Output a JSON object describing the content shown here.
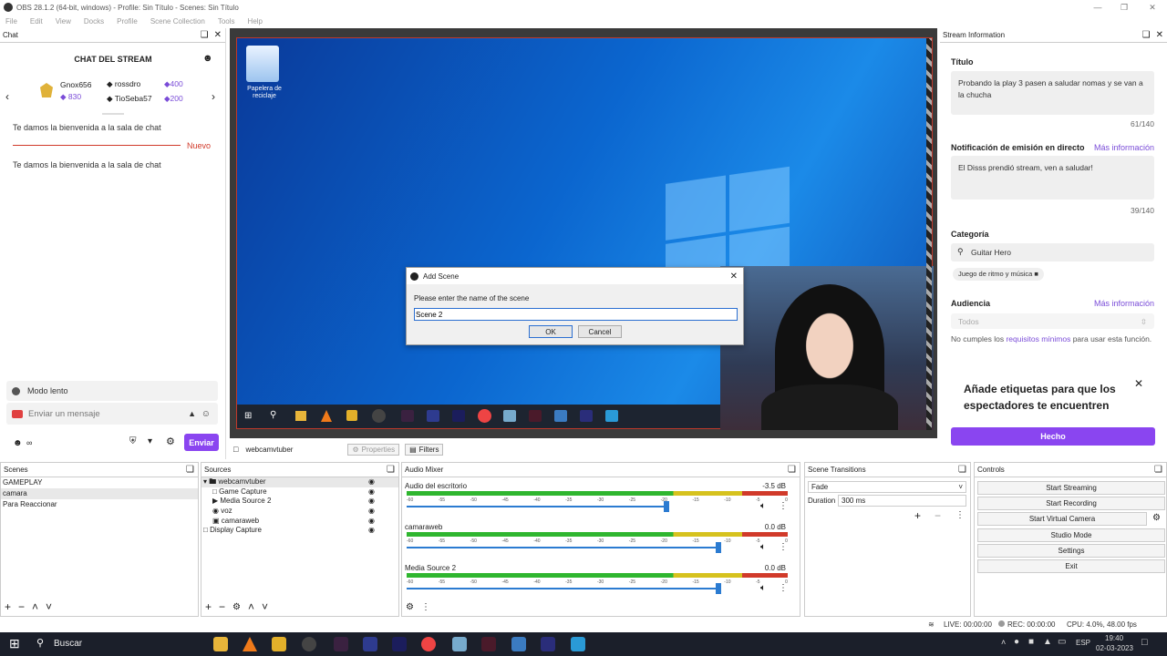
{
  "window": {
    "title": "OBS 28.1.2 (64-bit, windows) - Profile: Sin Título - Scenes: Sin Título"
  },
  "menu": [
    "File",
    "Edit",
    "View",
    "Docks",
    "Profile",
    "Scene Collection",
    "Tools",
    "Help"
  ],
  "chat": {
    "dock_title": "Chat",
    "header": "CHAT DEL STREAM",
    "leaders": [
      {
        "name": "Gnox656",
        "points": "830"
      },
      {
        "name": "rossdro",
        "points": "400"
      },
      {
        "name": "TioSeba57",
        "points": "200"
      }
    ],
    "welcome": "Te damos la bienvenida a la sala de chat",
    "new_label": "Nuevo",
    "welcome2": "Te damos la bienvenida a la sala de chat",
    "slow_mode": "Modo lento",
    "placeholder": "Enviar un mensaje",
    "infinity": "∞",
    "send": "Enviar"
  },
  "desktop": {
    "icon_label": "Papelera de reciclaje"
  },
  "dialog": {
    "title": "Add Scene",
    "prompt": "Please enter the name of the scene",
    "value": "Scene 2",
    "ok": "OK",
    "cancel": "Cancel"
  },
  "stream_info": {
    "dock_title": "Stream Information",
    "title_label": "Título",
    "title_value": "Probando la play 3 pasen a saludar nomas y se van a la chucha",
    "title_count": "61/140",
    "notif_label": "Notificación de emisión en directo",
    "more_info": "Más información",
    "notif_value": "El Disss prendió stream, ven a saludar!",
    "notif_count": "39/140",
    "category_label": "Categoría",
    "category_value": "Guitar Hero",
    "tag": "Juego de ritmo y música",
    "audience_label": "Audiencia",
    "audience_more": "Más información",
    "audience_select": "Todos",
    "audience_note_pre": "No cumples los ",
    "audience_note_link": "requisitos mínimos",
    "audience_note_post": " para usar esta función.",
    "tags_prompt": "Añade etiquetas para que los espectadores te encuentren",
    "done": "Hecho"
  },
  "source_toolbar": {
    "source": "webcamvtuber",
    "properties": "Properties",
    "filters": "Filters"
  },
  "scenes": {
    "title": "Scenes",
    "items": [
      "GAMEPLAY",
      "camara",
      "Para Reaccionar"
    ]
  },
  "sources": {
    "title": "Sources",
    "items": [
      "webcamvtuber",
      "Game Capture",
      "Media Source 2",
      "voz",
      "camaraweb",
      "Display Capture"
    ]
  },
  "mixer": {
    "title": "Audio Mixer",
    "channels": [
      {
        "name": "Audio del escritorio",
        "db": "-3.5 dB",
        "fader": 0.75
      },
      {
        "name": "camaraweb",
        "db": "0.0 dB",
        "fader": 0.9
      },
      {
        "name": "Media Source 2",
        "db": "0.0 dB",
        "fader": 0.9
      }
    ],
    "scale": [
      "-60",
      "-55",
      "-50",
      "-45",
      "-40",
      "-35",
      "-30",
      "-25",
      "-20",
      "-15",
      "-10",
      "-5",
      "0"
    ]
  },
  "transitions": {
    "title": "Scene Transitions",
    "type": "Fade",
    "duration_label": "Duration",
    "duration": "300 ms"
  },
  "controls": {
    "title": "Controls",
    "buttons": [
      "Start Streaming",
      "Start Recording",
      "Start Virtual Camera",
      "Studio Mode",
      "Settings",
      "Exit"
    ]
  },
  "status": {
    "live": "LIVE: 00:00:00",
    "rec": "REC: 00:00:00",
    "cpu": "CPU: 4.0%, 48.00 fps"
  },
  "taskbar": {
    "search": "Buscar",
    "lang": "ESP",
    "time": "19:40",
    "date": "02-03-2023"
  }
}
